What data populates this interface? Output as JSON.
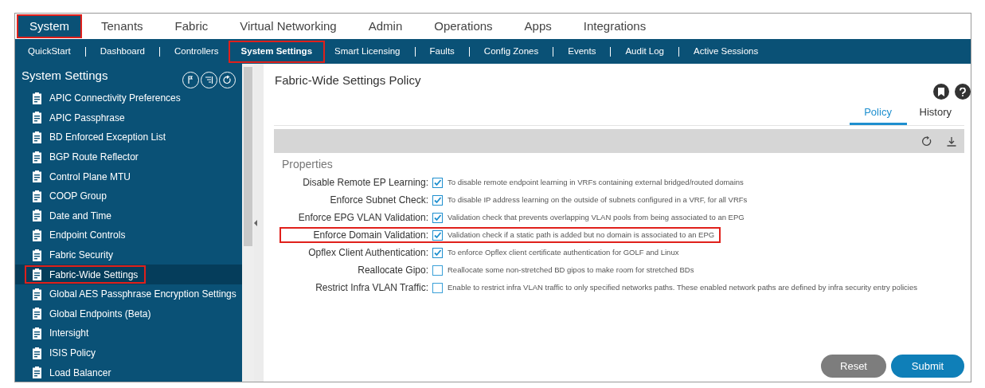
{
  "top_tabs": [
    {
      "label": "System",
      "selected": true,
      "highlighted": true
    },
    {
      "label": "Tenants",
      "selected": false,
      "highlighted": false
    },
    {
      "label": "Fabric",
      "selected": false,
      "highlighted": false
    },
    {
      "label": "Virtual Networking",
      "selected": false,
      "highlighted": false
    },
    {
      "label": "Admin",
      "selected": false,
      "highlighted": false
    },
    {
      "label": "Operations",
      "selected": false,
      "highlighted": false
    },
    {
      "label": "Apps",
      "selected": false,
      "highlighted": false
    },
    {
      "label": "Integrations",
      "selected": false,
      "highlighted": false
    }
  ],
  "sub_tabs": [
    {
      "label": "QuickStart",
      "selected": false,
      "highlighted": false
    },
    {
      "label": "Dashboard",
      "selected": false,
      "highlighted": false
    },
    {
      "label": "Controllers",
      "selected": false,
      "highlighted": false
    },
    {
      "label": "System Settings",
      "selected": true,
      "highlighted": true
    },
    {
      "label": "Smart Licensing",
      "selected": false,
      "highlighted": false
    },
    {
      "label": "Faults",
      "selected": false,
      "highlighted": false
    },
    {
      "label": "Config Zones",
      "selected": false,
      "highlighted": false
    },
    {
      "label": "Events",
      "selected": false,
      "highlighted": false
    },
    {
      "label": "Audit Log",
      "selected": false,
      "highlighted": false
    },
    {
      "label": "Active Sessions",
      "selected": false,
      "highlighted": false
    }
  ],
  "sidebar": {
    "title": "System Settings",
    "items": [
      {
        "label": "APIC Connectivity Preferences",
        "selected": false,
        "highlighted": false
      },
      {
        "label": "APIC Passphrase",
        "selected": false,
        "highlighted": false
      },
      {
        "label": "BD Enforced Exception List",
        "selected": false,
        "highlighted": false
      },
      {
        "label": "BGP Route Reflector",
        "selected": false,
        "highlighted": false
      },
      {
        "label": "Control Plane MTU",
        "selected": false,
        "highlighted": false
      },
      {
        "label": "COOP Group",
        "selected": false,
        "highlighted": false
      },
      {
        "label": "Date and Time",
        "selected": false,
        "highlighted": false
      },
      {
        "label": "Endpoint Controls",
        "selected": false,
        "highlighted": false
      },
      {
        "label": "Fabric Security",
        "selected": false,
        "highlighted": false
      },
      {
        "label": "Fabric-Wide Settings",
        "selected": true,
        "highlighted": true
      },
      {
        "label": "Global AES Passphrase Encryption Settings",
        "selected": false,
        "highlighted": false
      },
      {
        "label": "Global Endpoints (Beta)",
        "selected": false,
        "highlighted": false
      },
      {
        "label": "Intersight",
        "selected": false,
        "highlighted": false
      },
      {
        "label": "ISIS Policy",
        "selected": false,
        "highlighted": false
      },
      {
        "label": "Load Balancer",
        "selected": false,
        "highlighted": false
      }
    ]
  },
  "panel": {
    "title": "Fabric-Wide Settings Policy",
    "tabs": [
      {
        "label": "Policy",
        "selected": true
      },
      {
        "label": "History",
        "selected": false
      }
    ],
    "section": "Properties",
    "properties": [
      {
        "label": "Disable Remote EP Learning:",
        "checked": true,
        "highlighted": false,
        "description": "To disable remote endpoint learning in VRFs containing external bridged/routed domains"
      },
      {
        "label": "Enforce Subnet Check:",
        "checked": true,
        "highlighted": false,
        "description": "To disable IP address learning on the outside of subnets configured in a VRF, for all VRFs"
      },
      {
        "label": "Enforce EPG VLAN Validation:",
        "checked": true,
        "highlighted": false,
        "description": "Validation check that prevents overlapping VLAN pools from being associated to an EPG"
      },
      {
        "label": "Enforce Domain Validation:",
        "checked": true,
        "highlighted": true,
        "description": "Validation check if a static path is added but no domain is associated to an EPG"
      },
      {
        "label": "Opflex Client Authentication:",
        "checked": true,
        "highlighted": false,
        "description": "To enforce Opflex client certificate authentication for GOLF and Linux"
      },
      {
        "label": "Reallocate Gipo:",
        "checked": false,
        "highlighted": false,
        "description": "Reallocate some non-stretched BD gipos to make room for stretched BDs"
      },
      {
        "label": "Restrict Infra VLAN Traffic:",
        "checked": false,
        "highlighted": false,
        "description": "Enable to restrict infra VLAN traffic to only specified networks paths. These enabled network paths are defined by infra security entry policies"
      }
    ],
    "buttons": [
      "Reset",
      "Submit"
    ]
  }
}
